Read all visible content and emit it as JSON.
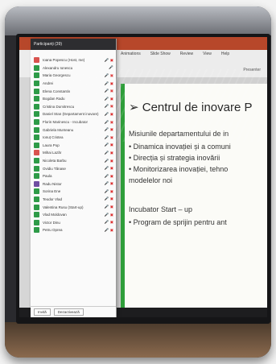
{
  "panel": {
    "title": "Participanți (39)",
    "participants": [
      {
        "color": "#d9534f",
        "name": "Ioana Popescu (Host, me)",
        "icons": "🎤 ▣"
      },
      {
        "color": "#2e9b48",
        "name": "Alexandru Ionescu",
        "icons": "🎤"
      },
      {
        "color": "#2e9b48",
        "name": "Maria Georgescu",
        "icons": "🎤 ▣"
      },
      {
        "color": "#2e9b48",
        "name": "Andrei",
        "icons": "🎤 ▣"
      },
      {
        "color": "#2e9b48",
        "name": "Elena Constantin",
        "icons": "🎤 ▣"
      },
      {
        "color": "#2e9b48",
        "name": "Bogdan Radu",
        "icons": "🎤 ▣"
      },
      {
        "color": "#2e9b48",
        "name": "Cristina Dumitrescu",
        "icons": "🎤 ▣"
      },
      {
        "color": "#2e9b48",
        "name": "Daniel Stan (Departament inovare)",
        "icons": "🎤 ▣"
      },
      {
        "color": "#2e9b48",
        "name": "Florin Marinescu - Incubator",
        "icons": "🎤 ▣"
      },
      {
        "color": "#2e9b48",
        "name": "Gabriela Munteanu",
        "icons": "🎤 ▣"
      },
      {
        "color": "#2e9b48",
        "name": "Ionuț Cristea",
        "icons": "🎤 ▣"
      },
      {
        "color": "#2e9b48",
        "name": "Laura Pop",
        "icons": "🎤 ▣"
      },
      {
        "color": "#d9534f",
        "name": "Mihai Lazăr",
        "icons": "🎤 ▣"
      },
      {
        "color": "#2e9b48",
        "name": "Nicoleta Barbu",
        "icons": "🎤 ▣"
      },
      {
        "color": "#2e9b48",
        "name": "Ovidiu Tănase",
        "icons": "🎤 ▣"
      },
      {
        "color": "#2e9b48",
        "name": "Paula",
        "icons": "🎤 ▣"
      },
      {
        "color": "#6f4ea1",
        "name": "Radu Nistor",
        "icons": "🎤 ▣"
      },
      {
        "color": "#2e9b48",
        "name": "Sorina Ene",
        "icons": "🎤 ▣"
      },
      {
        "color": "#2e9b48",
        "name": "Teodor Vlad",
        "icons": "🎤 ▣"
      },
      {
        "color": "#2e9b48",
        "name": "Valentina Rusu (Start-up)",
        "icons": "🎤 ▣"
      },
      {
        "color": "#2e9b48",
        "name": "Vlad Moldovan",
        "icons": "🎤 ▣"
      },
      {
        "color": "#2e9b48",
        "name": "Victor Dinu",
        "icons": "🎤 ▣"
      },
      {
        "color": "#2e9b48",
        "name": "Petru Oprea",
        "icons": "🎤 ▣"
      }
    ],
    "invite_label": "Invită",
    "mute_label": "Dezactivează"
  },
  "ribbon": {
    "tabs": [
      "Animations",
      "Slide Show",
      "Review",
      "View",
      "Help"
    ],
    "right": "Presenter"
  },
  "slide": {
    "title": "Centrul de inovare P",
    "lines": [
      "Misiunile departamentului de in",
      "• Dinamica inovației și a comuni",
      "• Direcția și strategia inovării",
      "• Monitorizarea inovației, tehno",
      "   modelelor noi",
      "",
      "Incubator Start – up",
      "• Program de sprijin pentru ant"
    ]
  }
}
